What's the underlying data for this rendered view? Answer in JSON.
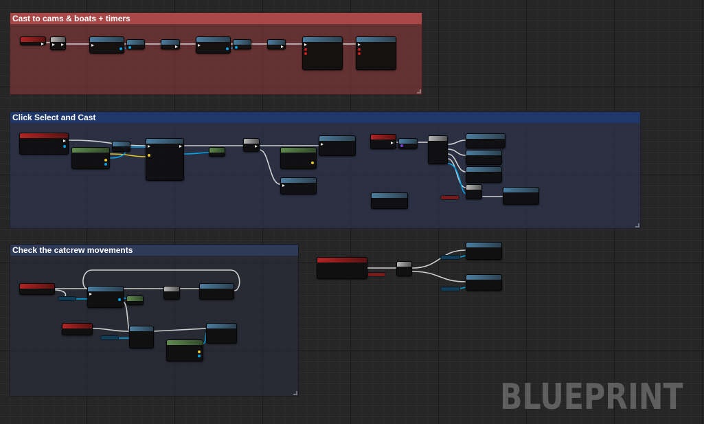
{
  "comments": {
    "timers": {
      "title": "Cast to cams & boats + timers"
    },
    "select": {
      "title": "Click Select and Cast"
    },
    "catcrew": {
      "title": "Check the catcrew movements"
    }
  },
  "watermark": {
    "text": "BLUEPRINT"
  },
  "colors": {
    "background": "#262626",
    "comment_red": "#a94848",
    "comment_blue": "#1f3769",
    "comment_slate": "#2f3958",
    "exec_wire": "#d0d0d0",
    "object_wire": "#00a3e8"
  },
  "icons": {
    "exec_pin": "triangle-right",
    "data_pin": "circle",
    "resize_grip": "corner-grip"
  }
}
